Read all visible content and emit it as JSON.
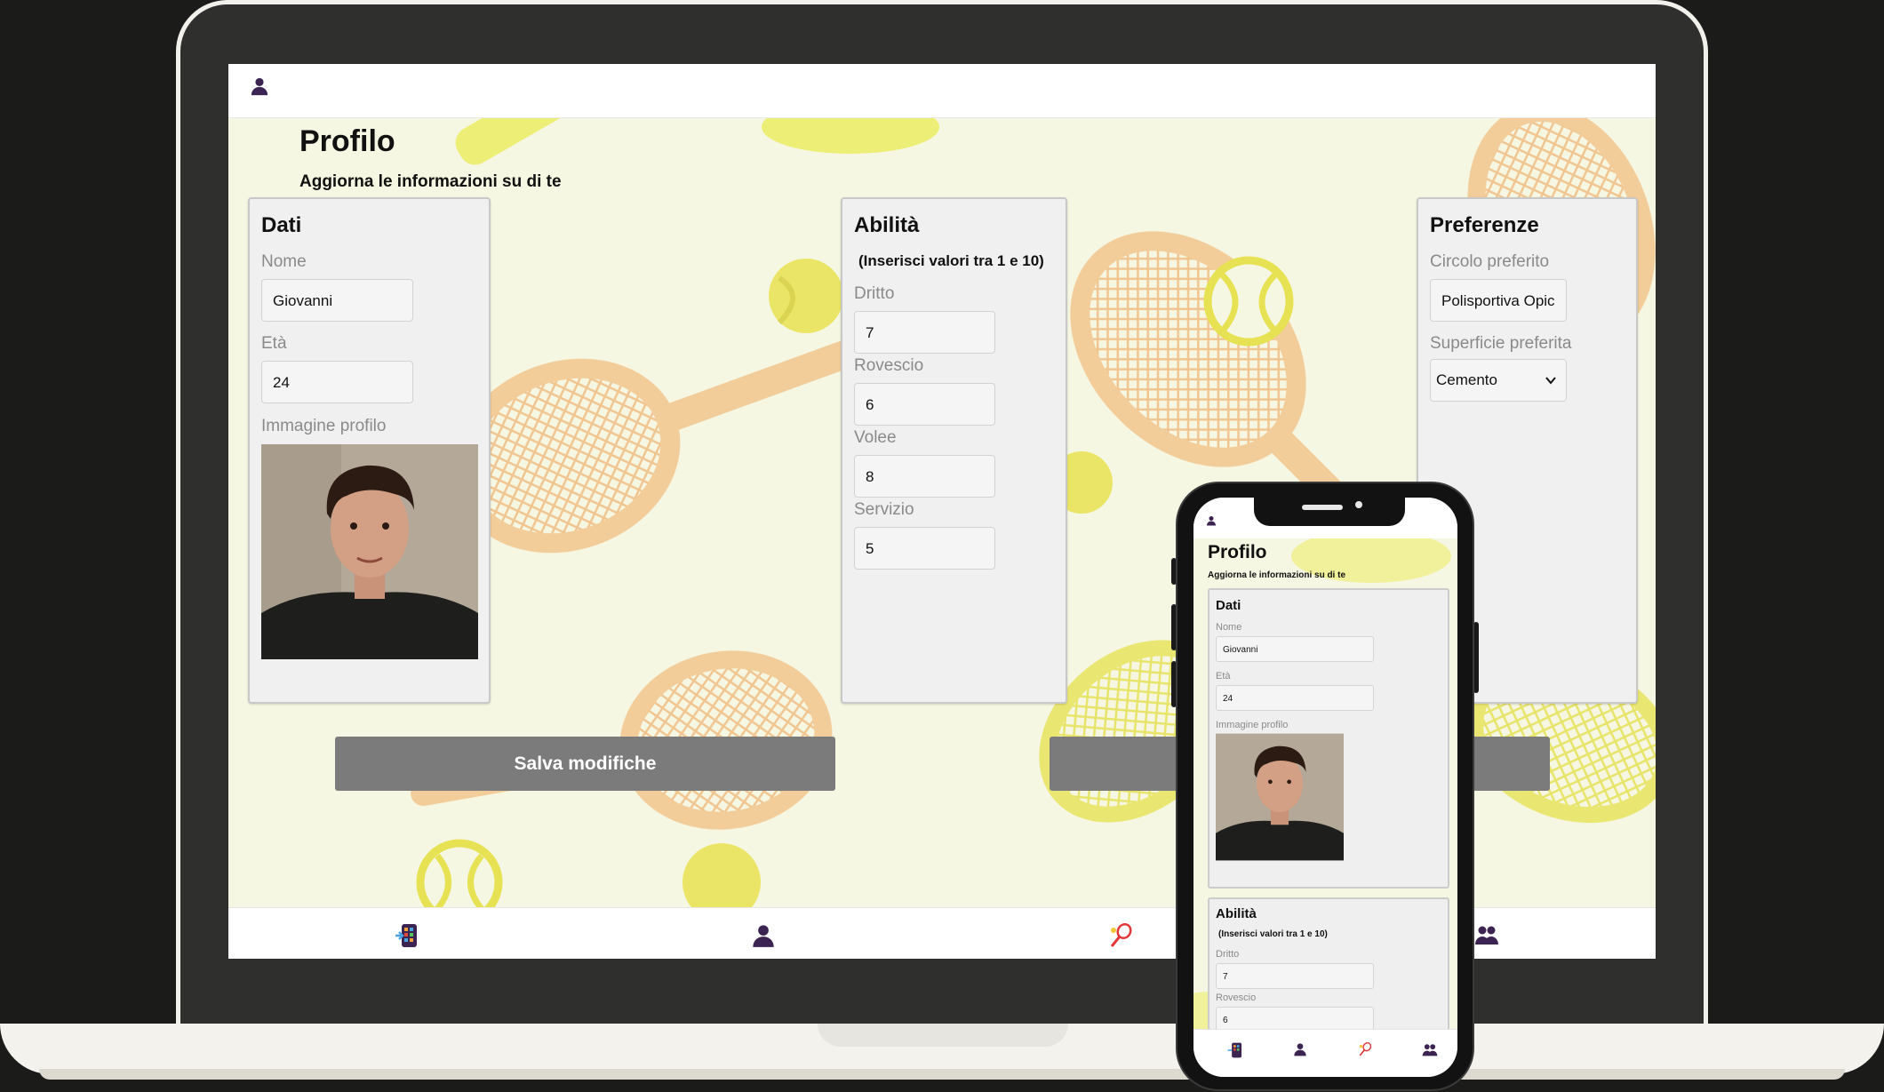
{
  "page": {
    "title": "Profilo",
    "subtitle": "Aggiorna le informazioni su di te"
  },
  "dati": {
    "title": "Dati",
    "nome_label": "Nome",
    "nome_value": "Giovanni",
    "eta_label": "Età",
    "eta_value": "24",
    "immagine_label": "Immagine profilo"
  },
  "abilita": {
    "title": "Abilità",
    "note": "(Inserisci valori tra 1 e 10)",
    "dritto_label": "Dritto",
    "dritto_value": "7",
    "rovescio_label": "Rovescio",
    "rovescio_value": "6",
    "volee_label": "Volee",
    "volee_value": "8",
    "servizio_label": "Servizio",
    "servizio_value": "5"
  },
  "preferenze": {
    "title": "Preferenze",
    "circolo_label": "Circolo preferito",
    "circolo_value": "Polisportiva Opic",
    "superficie_label": "Superficie preferita",
    "superficie_value": "Cemento"
  },
  "buttons": {
    "save_label": "Salva modifiche"
  },
  "nav": {
    "items": [
      "phone-grid-icon",
      "user-icon",
      "tennis-racket-icon",
      "users-icon"
    ]
  },
  "colors": {
    "accent_button": "#7b7b7b",
    "icon_purple": "#3b2352",
    "background_cream": "#f6f7e2",
    "racket_orange": "#f2c892",
    "ball_yellow": "#e7e15a"
  }
}
